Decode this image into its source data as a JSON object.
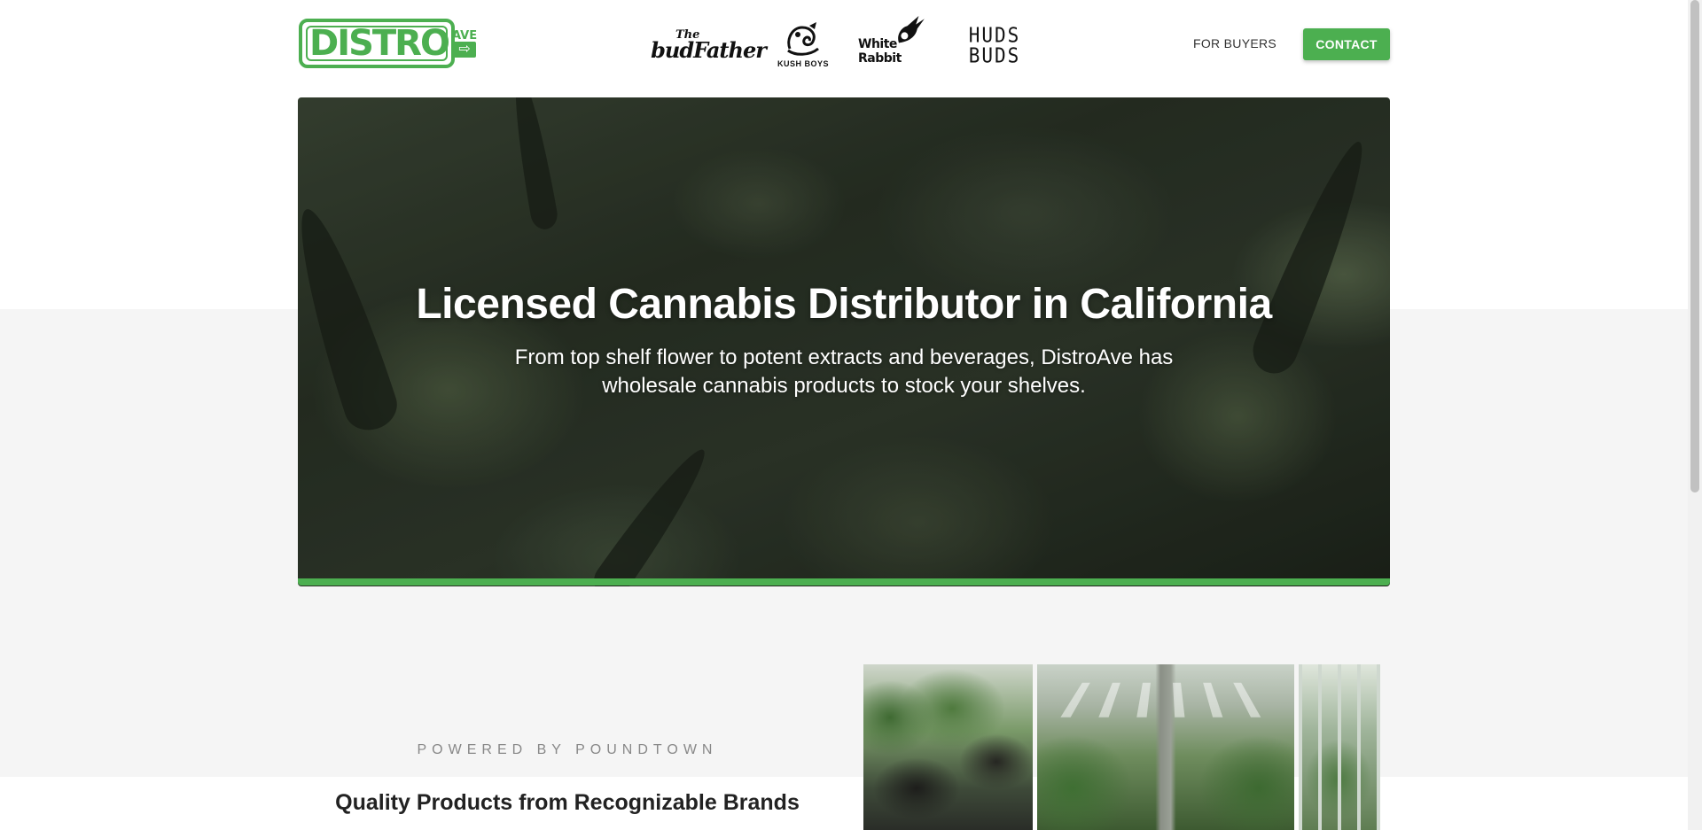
{
  "header": {
    "logo": {
      "word": "DISTRO",
      "side": "AVE",
      "arrow": "⇨"
    },
    "brands": [
      {
        "name": "budfather-logo",
        "line1": "The",
        "line2": "budFather"
      },
      {
        "name": "kush-boys-logo",
        "text": "KUSH BOYS"
      },
      {
        "name": "white-rabbit-logo",
        "text": "White Rabbit"
      },
      {
        "name": "huds-buds-logo",
        "line1": "HUDS",
        "line2": "BUDS"
      }
    ],
    "nav": {
      "for_buyers": "FOR BUYERS",
      "contact": "CONTACT"
    }
  },
  "hero": {
    "title": "Licensed Cannabis Distributor in California",
    "subtitle": "From top shelf flower to potent extracts and beverages, DistroAve has wholesale cannabis products to stock your shelves."
  },
  "section": {
    "eyebrow": "POWERED BY POUNDTOWN",
    "heading": "Quality Products from Recognizable Brands"
  },
  "colors": {
    "accent": "#4caf50",
    "page_grey": "#f5f5f5",
    "text": "#222222"
  }
}
